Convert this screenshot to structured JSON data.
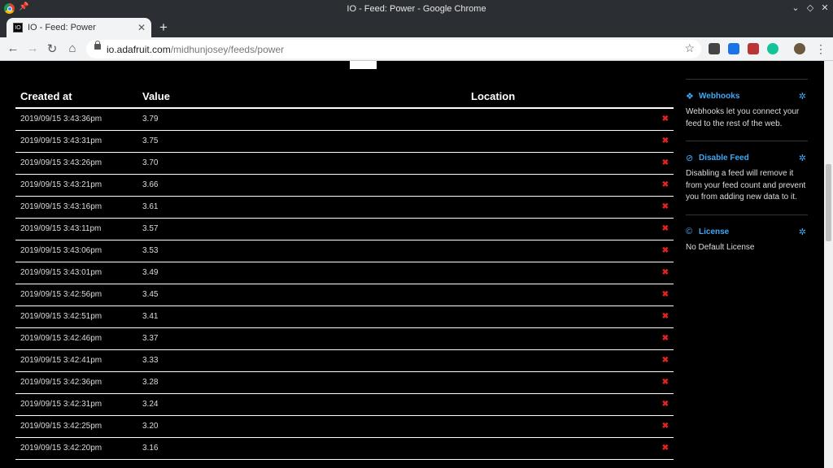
{
  "window": {
    "title": "IO - Feed: Power - Google Chrome"
  },
  "tab": {
    "favicon": "IO",
    "label": "IO - Feed: Power"
  },
  "address": {
    "host": "io.adafruit.com",
    "path": "/midhunjosey/feeds/power"
  },
  "table": {
    "headers": [
      "Created at",
      "Value",
      "Location"
    ],
    "rows": [
      [
        "2019/09/15 3:43:36pm",
        "3.79"
      ],
      [
        "2019/09/15 3:43:31pm",
        "3.75"
      ],
      [
        "2019/09/15 3:43:26pm",
        "3.70"
      ],
      [
        "2019/09/15 3:43:21pm",
        "3.66"
      ],
      [
        "2019/09/15 3:43:16pm",
        "3.61"
      ],
      [
        "2019/09/15 3:43:11pm",
        "3.57"
      ],
      [
        "2019/09/15 3:43:06pm",
        "3.53"
      ],
      [
        "2019/09/15 3:43:01pm",
        "3.49"
      ],
      [
        "2019/09/15 3:42:56pm",
        "3.45"
      ],
      [
        "2019/09/15 3:42:51pm",
        "3.41"
      ],
      [
        "2019/09/15 3:42:46pm",
        "3.37"
      ],
      [
        "2019/09/15 3:42:41pm",
        "3.33"
      ],
      [
        "2019/09/15 3:42:36pm",
        "3.28"
      ],
      [
        "2019/09/15 3:42:31pm",
        "3.24"
      ],
      [
        "2019/09/15 3:42:25pm",
        "3.20"
      ],
      [
        "2019/09/15 3:42:20pm",
        "3.16"
      ]
    ],
    "delete_glyph": "✖"
  },
  "sidebar": {
    "webhooks": {
      "title": "Webhooks",
      "body": "Webhooks let you connect your feed to the rest of the web."
    },
    "disable": {
      "title": "Disable Feed",
      "body": "Disabling a feed will remove it from your feed count and prevent you from adding new data to it."
    },
    "license": {
      "title": "License",
      "body": "No Default License"
    }
  },
  "colors": {
    "accent": "#3fa9f5",
    "delete": "#e52222"
  }
}
